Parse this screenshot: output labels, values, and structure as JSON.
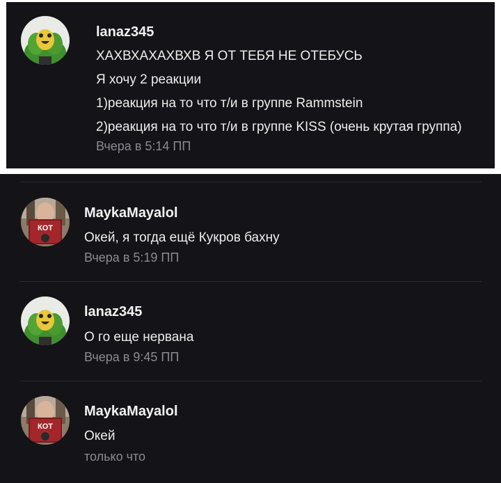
{
  "top_message": {
    "username": "lanaz345",
    "lines": [
      "ХАХВХАХАХВХВ Я ОТ ТЕБЯ НЕ ОТЕБУСЬ",
      "Я хочу 2 реакции",
      "1)реакция на то что т/и в группе Rammstein",
      "2)реакция на то что т/и в группе KISS (очень крутая группа)"
    ],
    "time": "Вчера в 5:14 ПП",
    "avatar": "parrot-avatar"
  },
  "messages": [
    {
      "username": "MaykaMayalol",
      "text": "Окей, я тогда ещё Кукров бахну",
      "time": "Вчера в 5:19 ПП",
      "avatar": "book-avatar",
      "avatar_book_text": "КОТ"
    },
    {
      "username": "lanaz345",
      "text": "О го еще нервана",
      "time": "Вчера в 9:45 ПП",
      "avatar": "parrot-avatar"
    },
    {
      "username": "MaykaMayalol",
      "text": "Окей",
      "time": "только что",
      "avatar": "book-avatar",
      "avatar_book_text": "КОТ"
    }
  ],
  "colors": {
    "background": "#141317",
    "username": "#f2f2f2",
    "text": "#ededed",
    "time": "#8b8b91",
    "divider": "#2c2b31"
  }
}
